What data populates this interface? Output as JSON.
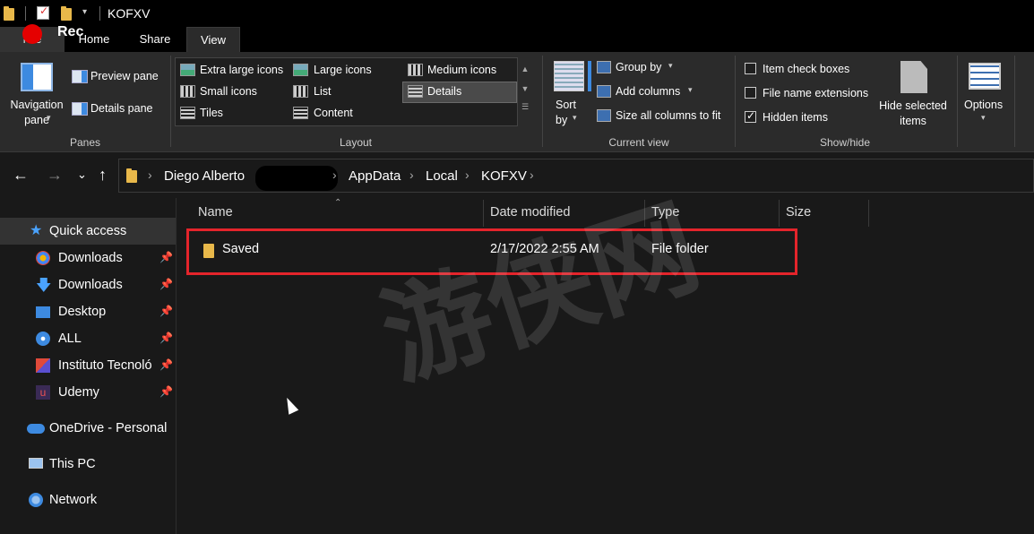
{
  "window": {
    "title": "KOFXV"
  },
  "recording": {
    "label": "Rec"
  },
  "tabs": [
    {
      "label": "File"
    },
    {
      "label": "Home"
    },
    {
      "label": "Share"
    },
    {
      "label": "View"
    }
  ],
  "ribbon": {
    "panes": {
      "label": "Panes",
      "navigation_pane": "Navigation\npane",
      "preview_pane": "Preview pane",
      "details_pane": "Details pane"
    },
    "layout": {
      "label": "Layout",
      "options": [
        "Extra large icons",
        "Large icons",
        "Medium icons",
        "Small icons",
        "List",
        "Details",
        "Tiles",
        "Content"
      ],
      "selected": "Details"
    },
    "current_view": {
      "label": "Current view",
      "sort_by": "Sort\nby",
      "group_by": "Group by",
      "add_columns": "Add columns",
      "size_all_columns": "Size all columns to fit"
    },
    "show_hide": {
      "label": "Show/hide",
      "item_check_boxes": {
        "label": "Item check boxes",
        "checked": false
      },
      "file_name_extensions": {
        "label": "File name extensions",
        "checked": false
      },
      "hidden_items": {
        "label": "Hidden items",
        "checked": true
      },
      "hide_selected": "Hide selected\nitems"
    },
    "options": {
      "label": "Options"
    }
  },
  "address": {
    "crumbs": [
      "Diego Alberto",
      "AppData",
      "Local",
      "KOFXV"
    ]
  },
  "sidebar": {
    "items": [
      {
        "label": "Quick access",
        "pinned": false
      },
      {
        "label": "Downloads",
        "pinned": true
      },
      {
        "label": "Downloads",
        "pinned": true
      },
      {
        "label": "Desktop",
        "pinned": true
      },
      {
        "label": "ALL",
        "pinned": true
      },
      {
        "label": "Instituto Tecnoló",
        "pinned": true
      },
      {
        "label": "Udemy",
        "pinned": true
      },
      {
        "label": "OneDrive - Personal",
        "pinned": false
      },
      {
        "label": "This PC",
        "pinned": false
      },
      {
        "label": "Network",
        "pinned": false
      }
    ]
  },
  "file_list": {
    "columns": [
      "Name",
      "Date modified",
      "Type",
      "Size"
    ],
    "rows": [
      {
        "name": "Saved",
        "date_modified": "2/17/2022 2:55 AM",
        "type": "File folder",
        "size": ""
      }
    ]
  },
  "watermark": {
    "text": "游侠网"
  }
}
